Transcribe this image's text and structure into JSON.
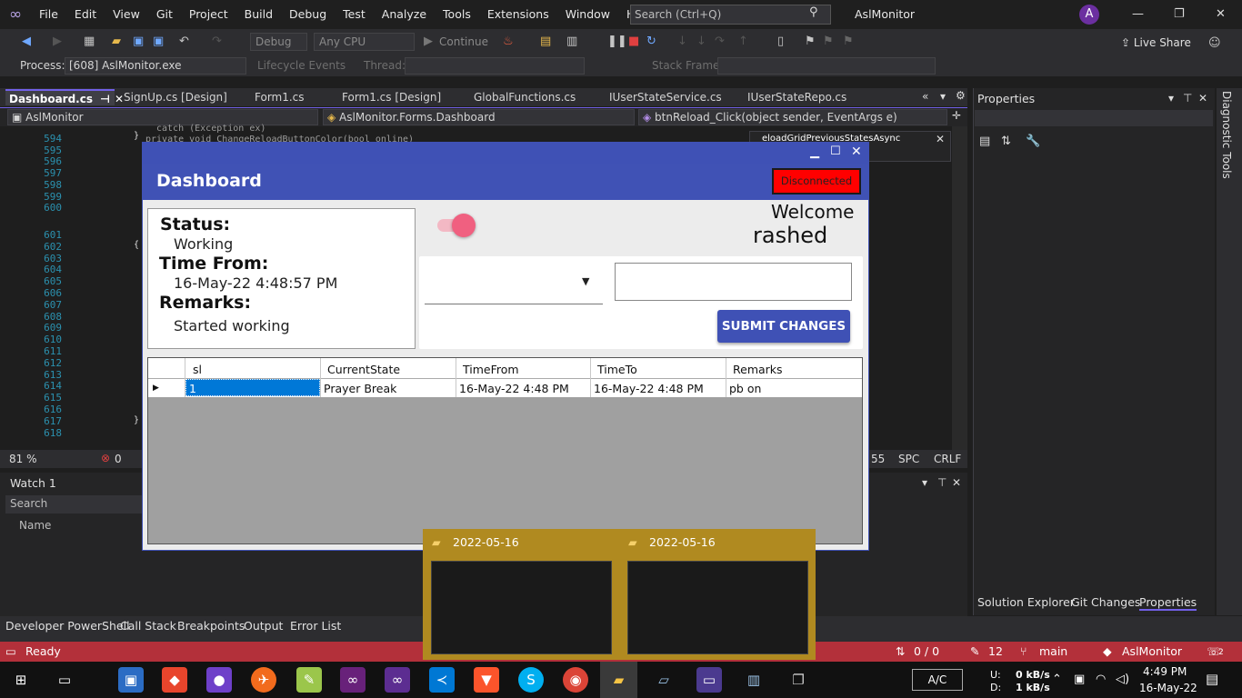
{
  "menu": [
    "File",
    "Edit",
    "View",
    "Git",
    "Project",
    "Build",
    "Debug",
    "Test",
    "Analyze",
    "Tools",
    "Extensions",
    "Window",
    "Help"
  ],
  "search": {
    "placeholder": "Search (Ctrl+Q)"
  },
  "solution_title": "AslMonitor",
  "avatar_letter": "A",
  "toolbar": {
    "config": "Debug",
    "platform": "Any CPU",
    "continue": "Continue",
    "live_share": "Live Share"
  },
  "process_bar": {
    "process_label": "Process:",
    "process_value": "[608] AslMonitor.exe",
    "lifecycle": "Lifecycle Events",
    "thread_label": "Thread:",
    "stack_frame": "Stack Frame:"
  },
  "doc_tabs": [
    "Dashboard.cs",
    "SignUp.cs [Design]",
    "Form1.cs",
    "Form1.cs [Design]",
    "GlobalFunctions.cs",
    "IUserStateService.cs",
    "IUserStateRepo.cs"
  ],
  "nav": {
    "project": "AslMonitor",
    "class": "AslMonitor.Forms.Dashboard",
    "member": "btnReload_Click(object sender, EventArgs e)",
    "peek": "eloadGridPreviousStatesAsync"
  },
  "editor": {
    "lines": [
      "594",
      "595",
      "596",
      "597",
      "598",
      "599",
      "600",
      "601",
      "602",
      "603",
      "604",
      "605",
      "606",
      "607",
      "608",
      "609",
      "610",
      "611",
      "612",
      "613",
      "614",
      "615",
      "616",
      "617",
      "618"
    ],
    "code_catch": "catch (Exception ex)",
    "code_method": "private void ChangeReloadButtonColor(bool online)",
    "zoom": "81 %",
    "errors": "0",
    "col": "55",
    "spc": "SPC",
    "crlf": "CRLF"
  },
  "watch": {
    "title": "Watch 1",
    "search": "Search",
    "col_name": "Name"
  },
  "bottom_tabs": [
    "Developer PowerShell",
    "Call Stack",
    "Breakpoints",
    "Output",
    "Error List"
  ],
  "properties": {
    "title": "Properties",
    "tabs": [
      "Solution Explorer",
      "Git Changes",
      "Properties"
    ],
    "diagnostic": "Diagnostic Tools"
  },
  "status": {
    "ready": "Ready",
    "changes": "0 / 0",
    "edits": "12",
    "branch": "main",
    "repo": "AslMonitor",
    "notifications": "2"
  },
  "taskbar": {
    "lang": "A/C",
    "upload": "0 kB/s",
    "download": "1 kB/s",
    "u_label": "U:",
    "d_label": "D:",
    "time": "4:49 PM",
    "date": "16-May-22"
  },
  "thumbnails": [
    {
      "label": "2022-05-16"
    },
    {
      "label": "2022-05-16"
    }
  ],
  "dashboard": {
    "title": "Dashboard",
    "connection": "Disconnected",
    "status_label": "Status:",
    "status_value": "Working",
    "time_from_label": "Time From:",
    "time_from_value": "16-May-22 4:48:57 PM",
    "remarks_label": "Remarks:",
    "remarks_value": "Started working",
    "welcome": "Welcome",
    "username": "rashed",
    "submit": "SUBMIT CHANGES",
    "grid": {
      "columns": [
        "sl",
        "CurrentState",
        "TimeFrom",
        "TimeTo",
        "Remarks"
      ],
      "row": {
        "sl": "1",
        "state": "Prayer Break",
        "from": "16-May-22 4:48 PM",
        "to": "16-May-22 4:48 PM",
        "remarks": "pb on"
      }
    }
  },
  "colors": {
    "accent": "#3f51b5",
    "status_bar": "#b3303a",
    "disconnected": "#ff0000",
    "toggle": "#f06080",
    "selection": "#0078d7"
  }
}
